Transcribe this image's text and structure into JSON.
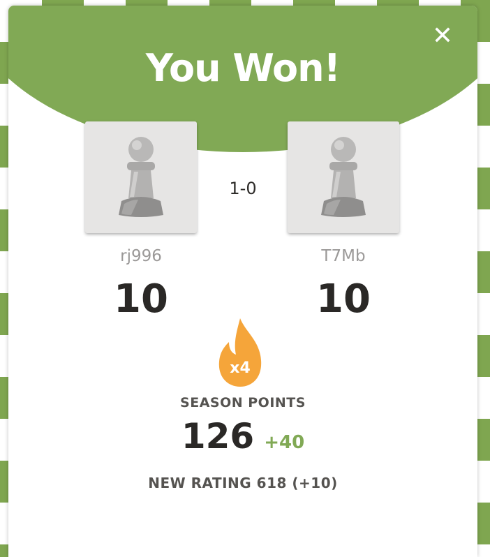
{
  "modal": {
    "title": "You Won!",
    "close_icon": "close-icon",
    "header_color": "#81a955"
  },
  "players": [
    {
      "username": "rj996",
      "rating": "10",
      "avatar_icon": "pawn-icon"
    },
    {
      "username": "T7Mb",
      "rating": "10",
      "avatar_icon": "pawn-icon"
    }
  ],
  "result": {
    "score": "1-0"
  },
  "season": {
    "multiplier": "x4",
    "icon": "flame-icon",
    "label": "SEASON POINTS",
    "points": "126",
    "delta": "+40",
    "delta_color": "#81a955",
    "flame_color": "#f5a53a"
  },
  "footer": {
    "new_rating": "NEW RATING 618 (+10)"
  }
}
